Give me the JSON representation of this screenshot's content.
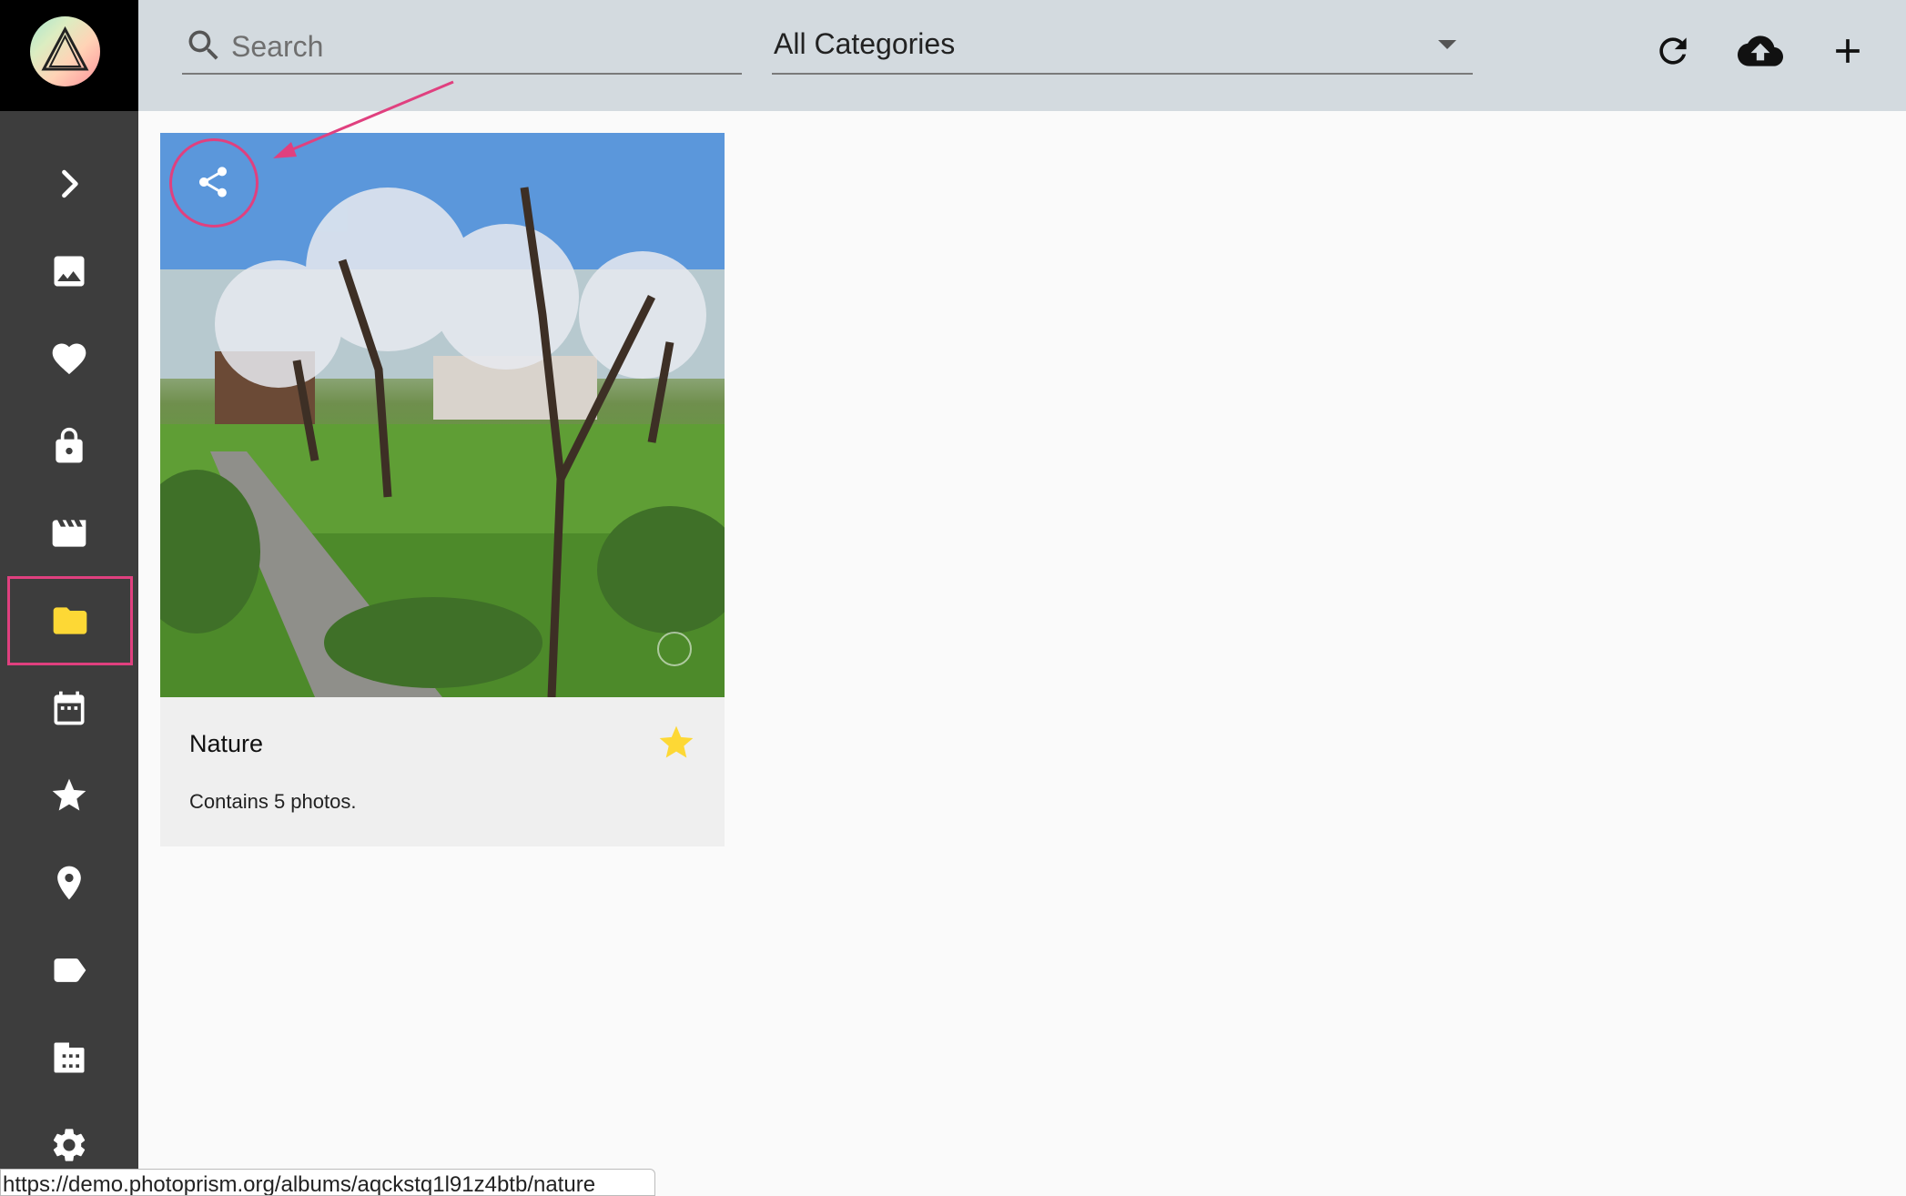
{
  "search": {
    "placeholder": "Search"
  },
  "category_filter": {
    "selected": "All Categories"
  },
  "toolbar": {
    "icons": [
      "refresh-icon",
      "cloud-upload-icon",
      "add-icon"
    ]
  },
  "sidebar": {
    "items": [
      {
        "name": "expand",
        "icon": "chevron-right-icon"
      },
      {
        "name": "photos",
        "icon": "image-icon"
      },
      {
        "name": "favorites",
        "icon": "heart-icon"
      },
      {
        "name": "private",
        "icon": "lock-icon"
      },
      {
        "name": "videos",
        "icon": "movie-icon"
      },
      {
        "name": "albums",
        "icon": "folder-icon",
        "active": true
      },
      {
        "name": "calendar",
        "icon": "calendar-icon"
      },
      {
        "name": "moments",
        "icon": "star-icon"
      },
      {
        "name": "places",
        "icon": "map-pin-icon"
      },
      {
        "name": "labels",
        "icon": "label-icon"
      },
      {
        "name": "folders",
        "icon": "film-folder-icon"
      },
      {
        "name": "settings",
        "icon": "gear-icon"
      }
    ],
    "accent_color": "#fdd835"
  },
  "album": {
    "title": "Nature",
    "description": "Contains 5 photos.",
    "favorite": true
  },
  "status_url": "https://demo.photoprism.org/albums/aqckstq1l91z4btb/nature",
  "colors": {
    "sidebar": "#3d3d3d",
    "toolbar": "#d3dadf",
    "highlight": "#e0407f",
    "star": "#fdd835"
  }
}
